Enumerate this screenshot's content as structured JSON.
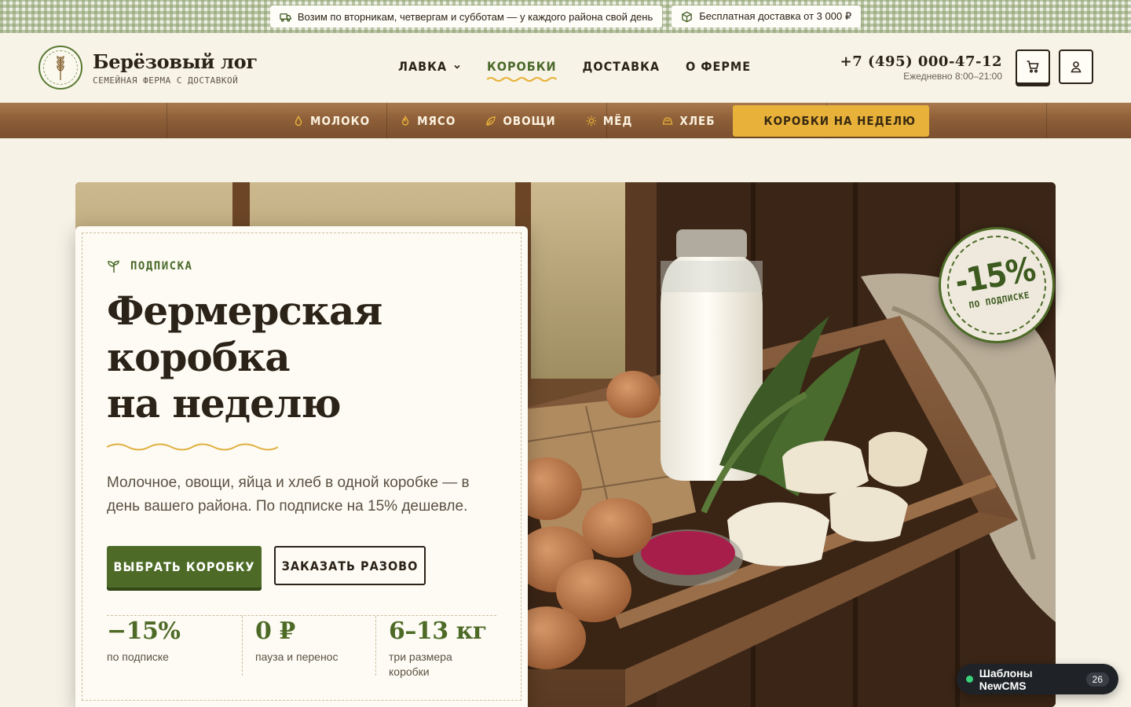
{
  "topbar": {
    "schedule_text": "Возим по вторникам, четвергам и субботам — у каждого района свой день",
    "delivery_text": "Бесплатная доставка от 3 000 ₽"
  },
  "header": {
    "brand_name": "Берёзовый лог",
    "brand_tagline": "СЕМЕЙНАЯ ФЕРМА С ДОСТАВКОЙ",
    "nav": [
      {
        "label": "ЛАВКА",
        "has_dropdown": true
      },
      {
        "label": "КОРОБКИ",
        "active": true
      },
      {
        "label": "ДОСТАВКА"
      },
      {
        "label": "О ФЕРМЕ"
      }
    ],
    "phone": "+7 (495) 000-47-12",
    "hours": "Ежедневно 8:00–21:00"
  },
  "categories": {
    "items": [
      {
        "label": "МОЛОКО",
        "icon": "drop-icon"
      },
      {
        "label": "МЯСО",
        "icon": "flame-icon"
      },
      {
        "label": "ОВОЩИ",
        "icon": "leaf-icon"
      },
      {
        "label": "МЁД",
        "icon": "sun-icon"
      },
      {
        "label": "ХЛЕБ",
        "icon": "bread-icon"
      }
    ],
    "cta_label": "КОРОБКИ НА НЕДЕЛЮ"
  },
  "hero": {
    "eyebrow": "ПОДПИСКА",
    "title_lines": [
      "Фермерская",
      "коробка",
      "на неделю"
    ],
    "lead": "Молочное, овощи, яйца и хлеб в одной коробке — в день вашего района. По подписке на 15% дешевле.",
    "primary_button": "ВЫБРАТЬ КОРОБКУ",
    "secondary_button": "ЗАКАЗАТЬ РАЗОВО",
    "stats": [
      {
        "value": "−15%",
        "label": "по подписке"
      },
      {
        "value": "0 ₽",
        "label": "пауза и перенос"
      },
      {
        "value": "6–13 кг",
        "label": "три размера коробки"
      }
    ],
    "badge": {
      "value": "-15%",
      "label": "ПО ПОДПИСКЕ"
    }
  },
  "widget": {
    "label": "Шаблоны NewCMS",
    "count": "26"
  },
  "colors": {
    "accent_green": "#4d6b27",
    "accent_yellow": "#e8b23a",
    "wood": "#8e5f38",
    "cream": "#f6f2e6"
  }
}
